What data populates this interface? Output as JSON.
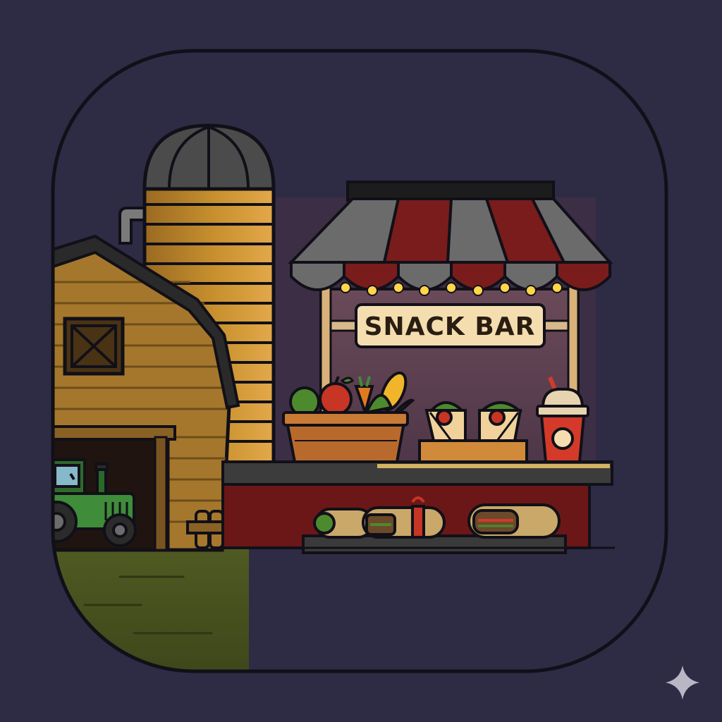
{
  "sign": {
    "text": "SNACK BAR"
  },
  "colors": {
    "background": "#2e2b45",
    "frame_stroke": "#111018",
    "barn": "#a8782d",
    "silo": "#c58b2c",
    "roof": "#2b2b2b",
    "awning_red": "#7a1c1c",
    "awning_gray": "#6e6e6e",
    "sign_bg": "#f4deb0",
    "grass": "#4a5520",
    "tractor": "#3f8c3a",
    "counter_red": "#6b1717"
  },
  "icons": {
    "corner_mark": "sparkle-icon"
  }
}
